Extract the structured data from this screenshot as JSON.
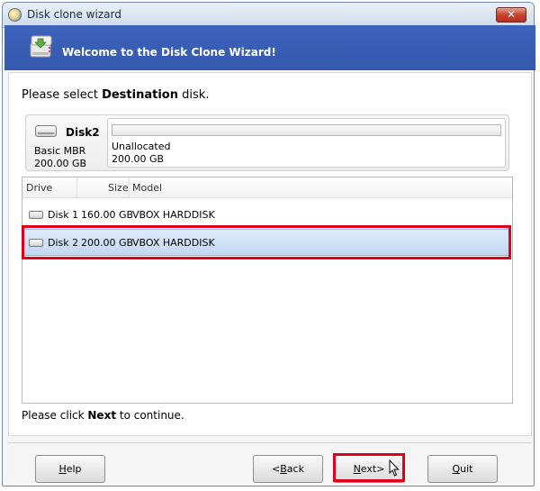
{
  "window": {
    "title": "Disk clone wizard",
    "close_glyph": "✕"
  },
  "banner": {
    "title": "Welcome to the Disk Clone Wizard!",
    "icon": "disk-clone-icon"
  },
  "prompt": {
    "prefix": "Please select ",
    "bold": "Destination",
    "suffix": " disk."
  },
  "selected_disk": {
    "name": "Disk2",
    "type": "Basic MBR",
    "size": "200.00 GB",
    "partition_label": "Unallocated",
    "partition_size": "200.00 GB"
  },
  "disk_list": {
    "columns": [
      "Drive",
      "Size",
      "Model"
    ],
    "rows": [
      {
        "drive": "Disk 1",
        "size": "160.00 GB",
        "model": "VBOX HARDDISK",
        "selected": false
      },
      {
        "drive": "Disk 2",
        "size": "200.00 GB",
        "model": "VBOX HARDDISK",
        "selected": true
      }
    ]
  },
  "footer": {
    "prefix": "Please click ",
    "bold": "Next",
    "suffix": " to continue."
  },
  "buttons": {
    "help": {
      "pre": "",
      "u": "H",
      "post": "elp"
    },
    "back": {
      "pre": "<",
      "u": "B",
      "post": "ack"
    },
    "next": {
      "pre": "",
      "u": "N",
      "post": "ext>"
    },
    "quit": {
      "pre": "",
      "u": "Q",
      "post": "uit"
    }
  },
  "colors": {
    "banner": "#3a5fb5",
    "highlight": "#e0001b",
    "selection": "#c3d7f3"
  }
}
